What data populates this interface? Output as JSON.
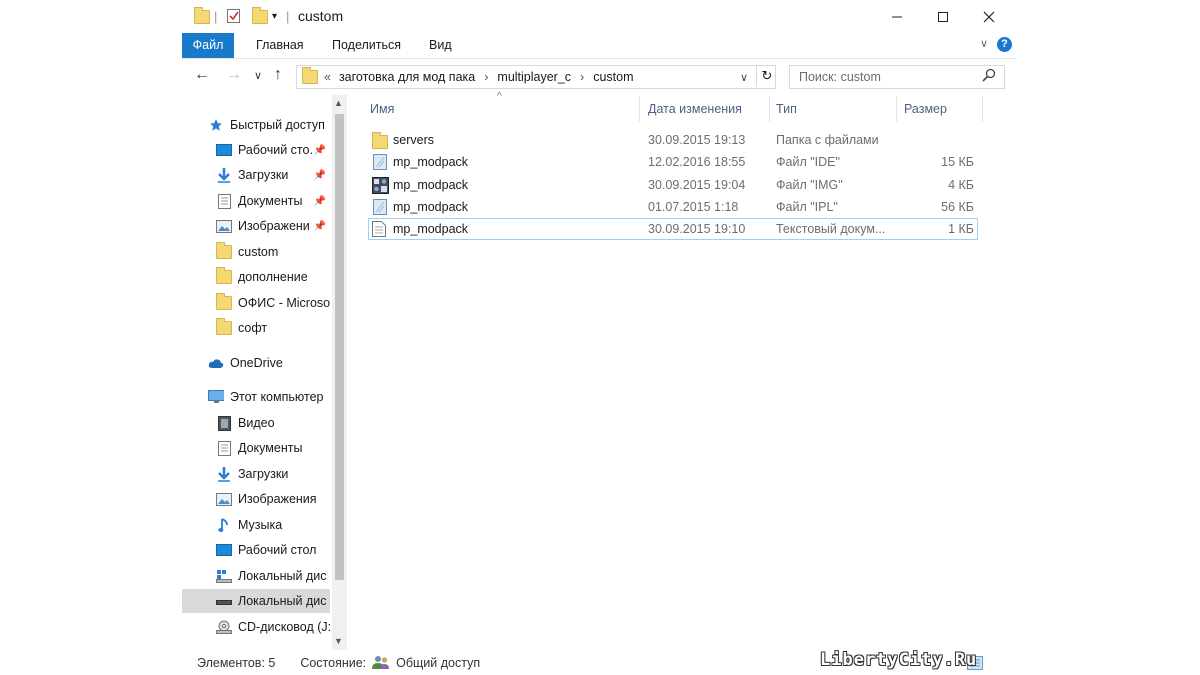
{
  "window": {
    "title": "custom"
  },
  "ribbon": {
    "tabs": [
      "Файл",
      "Главная",
      "Поделиться",
      "Вид"
    ]
  },
  "address": {
    "prefix": "«",
    "crumbs": [
      "заготовка для мод пака",
      "multiplayer_c",
      "custom"
    ]
  },
  "search": {
    "placeholder": "Поиск: custom"
  },
  "sidebar": {
    "quick_access": "Быстрый доступ",
    "pinned": [
      "Рабочий сто.",
      "Загрузки",
      "Документы",
      "Изображени"
    ],
    "folders": [
      "custom",
      "дополнение",
      "ОФИС - Microso",
      "софт"
    ],
    "onedrive": "OneDrive",
    "this_pc": "Этот компьютер",
    "pc_items": [
      "Видео",
      "Документы",
      "Загрузки",
      "Изображения",
      "Музыка",
      "Рабочий стол",
      "Локальный дис",
      "Локальный дис",
      "CD-дисковод (J:"
    ]
  },
  "columns": {
    "name": "Имя",
    "date": "Дата изменения",
    "type": "Тип",
    "size": "Размер"
  },
  "files": [
    {
      "name": "servers",
      "date": "30.09.2015 19:13",
      "type": "Папка с файлами",
      "size": "",
      "icon": "folder-icon"
    },
    {
      "name": "mp_modpack",
      "date": "12.02.2016 18:55",
      "type": "Файл \"IDE\"",
      "size": "15 КБ",
      "icon": "file-icon"
    },
    {
      "name": "mp_modpack",
      "date": "30.09.2015 19:04",
      "type": "Файл \"IMG\"",
      "size": "4 КБ",
      "icon": "img-icon"
    },
    {
      "name": "mp_modpack",
      "date": "01.07.2015 1:18",
      "type": "Файл \"IPL\"",
      "size": "56 КБ",
      "icon": "file-icon"
    },
    {
      "name": "mp_modpack",
      "date": "30.09.2015 19:10",
      "type": "Текстовый докум...",
      "size": "1 КБ",
      "icon": "text-doc-icon"
    }
  ],
  "status": {
    "count": "Элементов: 5",
    "state_label": "Состояние:",
    "state_value": "Общий доступ"
  },
  "watermark": "LibertyCity.Ru",
  "colors": {
    "accent": "#1979ca",
    "folder": "#f4d874",
    "selection_border": "#99d1ff"
  }
}
